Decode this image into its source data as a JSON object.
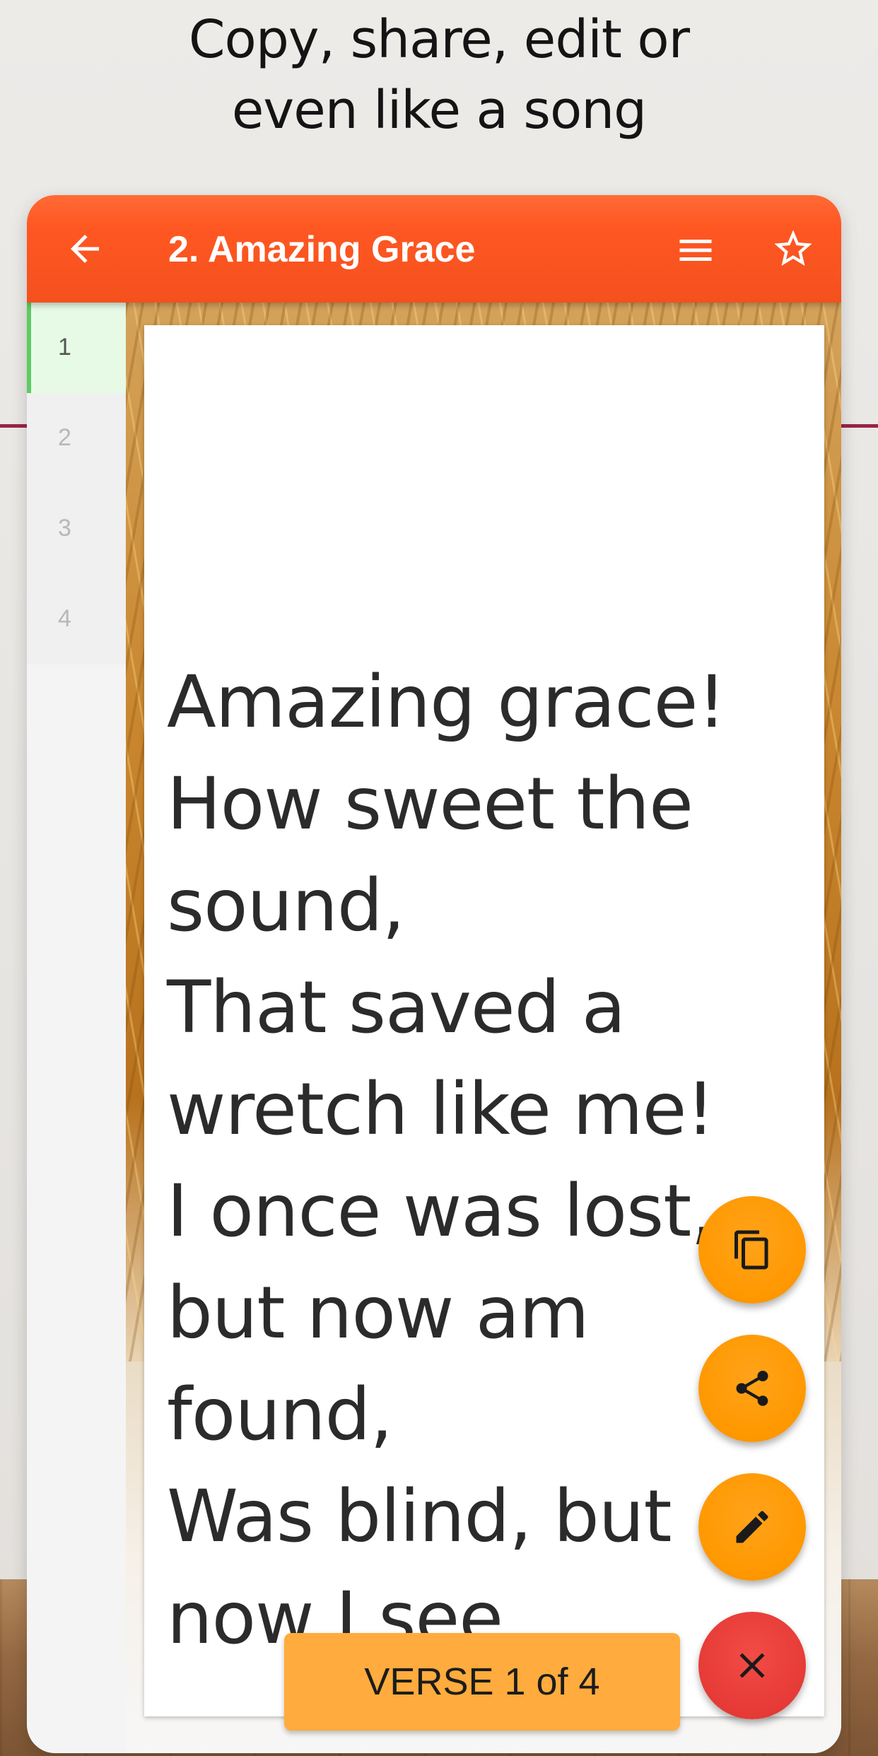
{
  "promo": {
    "headline_line1": "Copy, share, edit or",
    "headline_line2": "even like a song"
  },
  "appbar": {
    "title": "2. Amazing Grace",
    "background_color": "#ff5722",
    "back_icon": "arrow-back-icon",
    "menu_icon": "menu-icon",
    "favorite_icon": "star-outline-icon"
  },
  "sidebar": {
    "verses": [
      {
        "label": "1",
        "active": true
      },
      {
        "label": "2",
        "active": false
      },
      {
        "label": "3",
        "active": false
      },
      {
        "label": "4",
        "active": false
      }
    ],
    "active_color": "#5ecb64"
  },
  "lyrics": {
    "text": "Amazing grace!\nHow sweet the\nsound,\nThat saved a\nwretch like me!\nI once was lost,\nbut now am\nfound,\nWas blind, but\nnow I see."
  },
  "actions": {
    "copy_icon": "copy-icon",
    "share_icon": "share-icon",
    "edit_icon": "edit-pencil-icon",
    "close_icon": "close-icon",
    "action_color": "#ff9800",
    "close_color": "#e53935"
  },
  "verse_indicator": {
    "label": "VERSE 1 of 4"
  }
}
